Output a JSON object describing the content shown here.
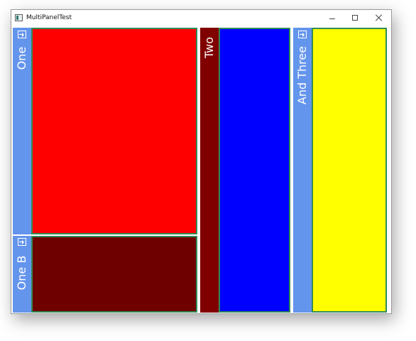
{
  "window": {
    "title": "MultiPanelTest",
    "controls": {
      "minimize": "minimize",
      "maximize": "maximize",
      "close": "close"
    }
  },
  "panels": [
    {
      "id": "one",
      "label": "One",
      "tab_color": "#6495ed",
      "content_color": "#ff0000",
      "border_color": "#2e8b57"
    },
    {
      "id": "one-b",
      "label": "One B",
      "tab_color": "#6495ed",
      "content_color": "#6e0000",
      "border_color": "#2e8b57"
    },
    {
      "id": "two",
      "label": "Two",
      "tab_color": "#800000",
      "content_color": "#0000ff",
      "border_color": "#2e8b57"
    },
    {
      "id": "and-three",
      "label": "And Three",
      "tab_color": "#6495ed",
      "content_color": "#ffff00",
      "border_color": "#2e8b57"
    }
  ],
  "icons": {
    "pin": "pin-icon",
    "app": "app-icon"
  }
}
